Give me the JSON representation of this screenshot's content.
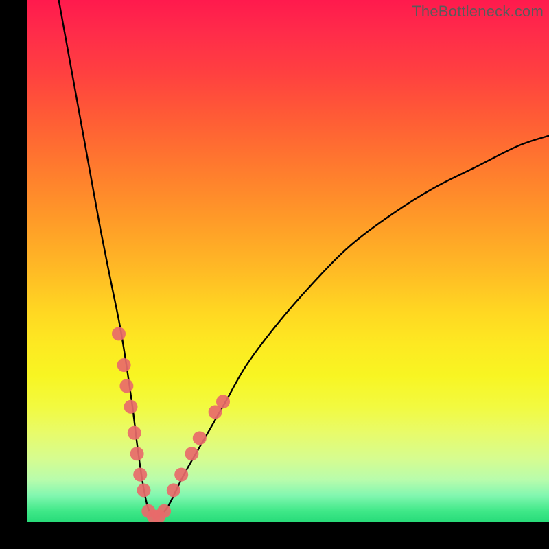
{
  "watermark": "TheBottleneck.com",
  "chart_data": {
    "type": "line",
    "title": "",
    "xlabel": "",
    "ylabel": "",
    "xlim": [
      0,
      100
    ],
    "ylim": [
      0,
      100
    ],
    "series": [
      {
        "name": "bottleneck-curve",
        "x": [
          6,
          8,
          10,
          12,
          14,
          16,
          18,
          20,
          21,
          22,
          23,
          24,
          25,
          27,
          30,
          34,
          38,
          42,
          48,
          55,
          62,
          70,
          78,
          86,
          94,
          100
        ],
        "values": [
          100,
          89,
          78,
          67,
          56,
          46,
          36,
          23,
          15,
          8,
          3,
          1,
          1,
          3,
          9,
          16,
          23,
          30,
          38,
          46,
          53,
          59,
          64,
          68,
          72,
          74
        ]
      }
    ],
    "highlight_clusters": [
      {
        "name": "left-branch-dots",
        "points": [
          {
            "x": 17.5,
            "y": 36
          },
          {
            "x": 18.5,
            "y": 30
          },
          {
            "x": 19.0,
            "y": 26
          },
          {
            "x": 19.8,
            "y": 22
          },
          {
            "x": 20.5,
            "y": 17
          },
          {
            "x": 21.0,
            "y": 13
          },
          {
            "x": 21.6,
            "y": 9
          },
          {
            "x": 22.3,
            "y": 6
          }
        ]
      },
      {
        "name": "trough-dots",
        "points": [
          {
            "x": 23.2,
            "y": 2
          },
          {
            "x": 24.2,
            "y": 1
          },
          {
            "x": 25.2,
            "y": 1
          },
          {
            "x": 26.2,
            "y": 2
          }
        ]
      },
      {
        "name": "right-branch-dots",
        "points": [
          {
            "x": 28.0,
            "y": 6
          },
          {
            "x": 29.5,
            "y": 9
          },
          {
            "x": 31.5,
            "y": 13
          },
          {
            "x": 33.0,
            "y": 16
          },
          {
            "x": 36.0,
            "y": 21
          },
          {
            "x": 37.5,
            "y": 23
          }
        ]
      }
    ],
    "colors": {
      "curve": "#000000",
      "dot_fill": "#e86a6a",
      "dot_stroke": "#c94f4f"
    }
  }
}
